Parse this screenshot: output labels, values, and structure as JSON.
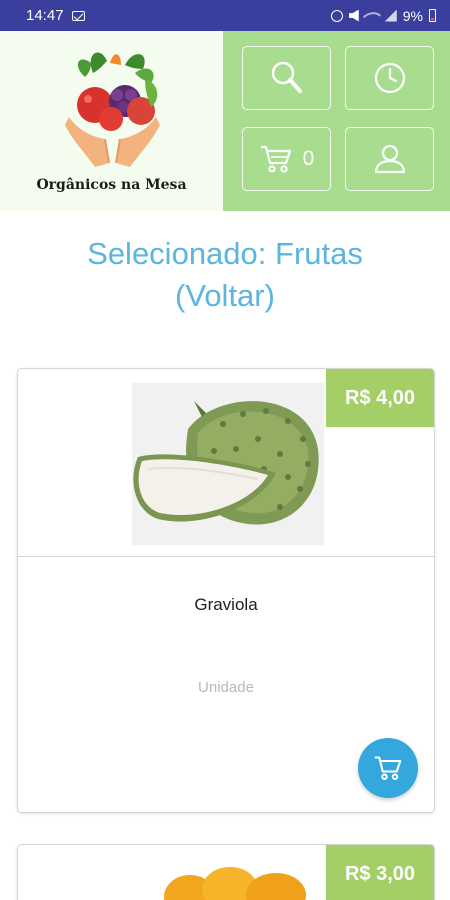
{
  "status_bar": {
    "time": "14:47",
    "battery": "9%"
  },
  "brand": {
    "name": "Orgânicos na Mesa"
  },
  "nav": {
    "cart_count": "0",
    "buttons": [
      "search-icon",
      "history-icon",
      "cart-icon",
      "user-icon"
    ]
  },
  "selection": {
    "label": "Selecionado: Frutas",
    "back_label": "(Voltar)"
  },
  "products": [
    {
      "price": "R$ 4,00",
      "name": "Graviola",
      "unit": "Unidade",
      "image": "soursop-fruit-image"
    },
    {
      "price": "R$ 3,00",
      "image": "oranges-image"
    }
  ],
  "colors": {
    "status_bar": "#3a3f9e",
    "header_green": "#a8dc8f",
    "price_badge": "#a3cf66",
    "title_blue": "#5bb5dc",
    "cart_button": "#34a7dd"
  }
}
